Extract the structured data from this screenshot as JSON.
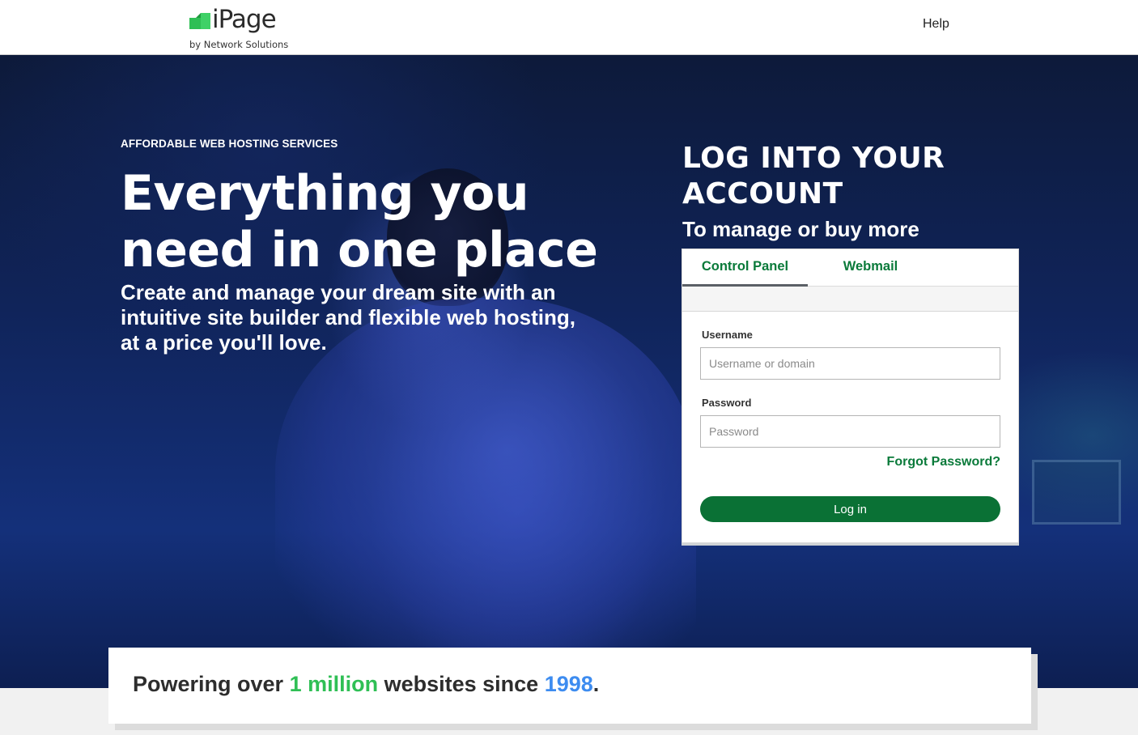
{
  "header": {
    "logo_text": "iPage",
    "logo_sub": "by Network Solutions",
    "help_label": "Help",
    "brand_green": "#2fbf55"
  },
  "hero": {
    "eyebrow": "AFFORDABLE WEB HOSTING SERVICES",
    "title": "Everything you need in one place",
    "subtitle": "Create and manage your dream site with an intuitive site builder and flexible web hosting, at a price you'll love."
  },
  "login": {
    "heading": "LOG INTO YOUR ACCOUNT",
    "subheading": "To manage or buy more",
    "tabs": [
      {
        "label": "Control Panel",
        "active": true
      },
      {
        "label": "Webmail",
        "active": false
      }
    ],
    "username": {
      "label": "Username",
      "placeholder": "Username or domain",
      "value": ""
    },
    "password": {
      "label": "Password",
      "placeholder": "Password",
      "value": ""
    },
    "forgot_label": "Forgot Password?",
    "submit_label": "Log in",
    "button_color": "#0a7135"
  },
  "stats": {
    "prefix": "Powering over ",
    "highlight_count": "1 million",
    "middle": " websites since ",
    "highlight_year": "1998",
    "suffix": "."
  }
}
